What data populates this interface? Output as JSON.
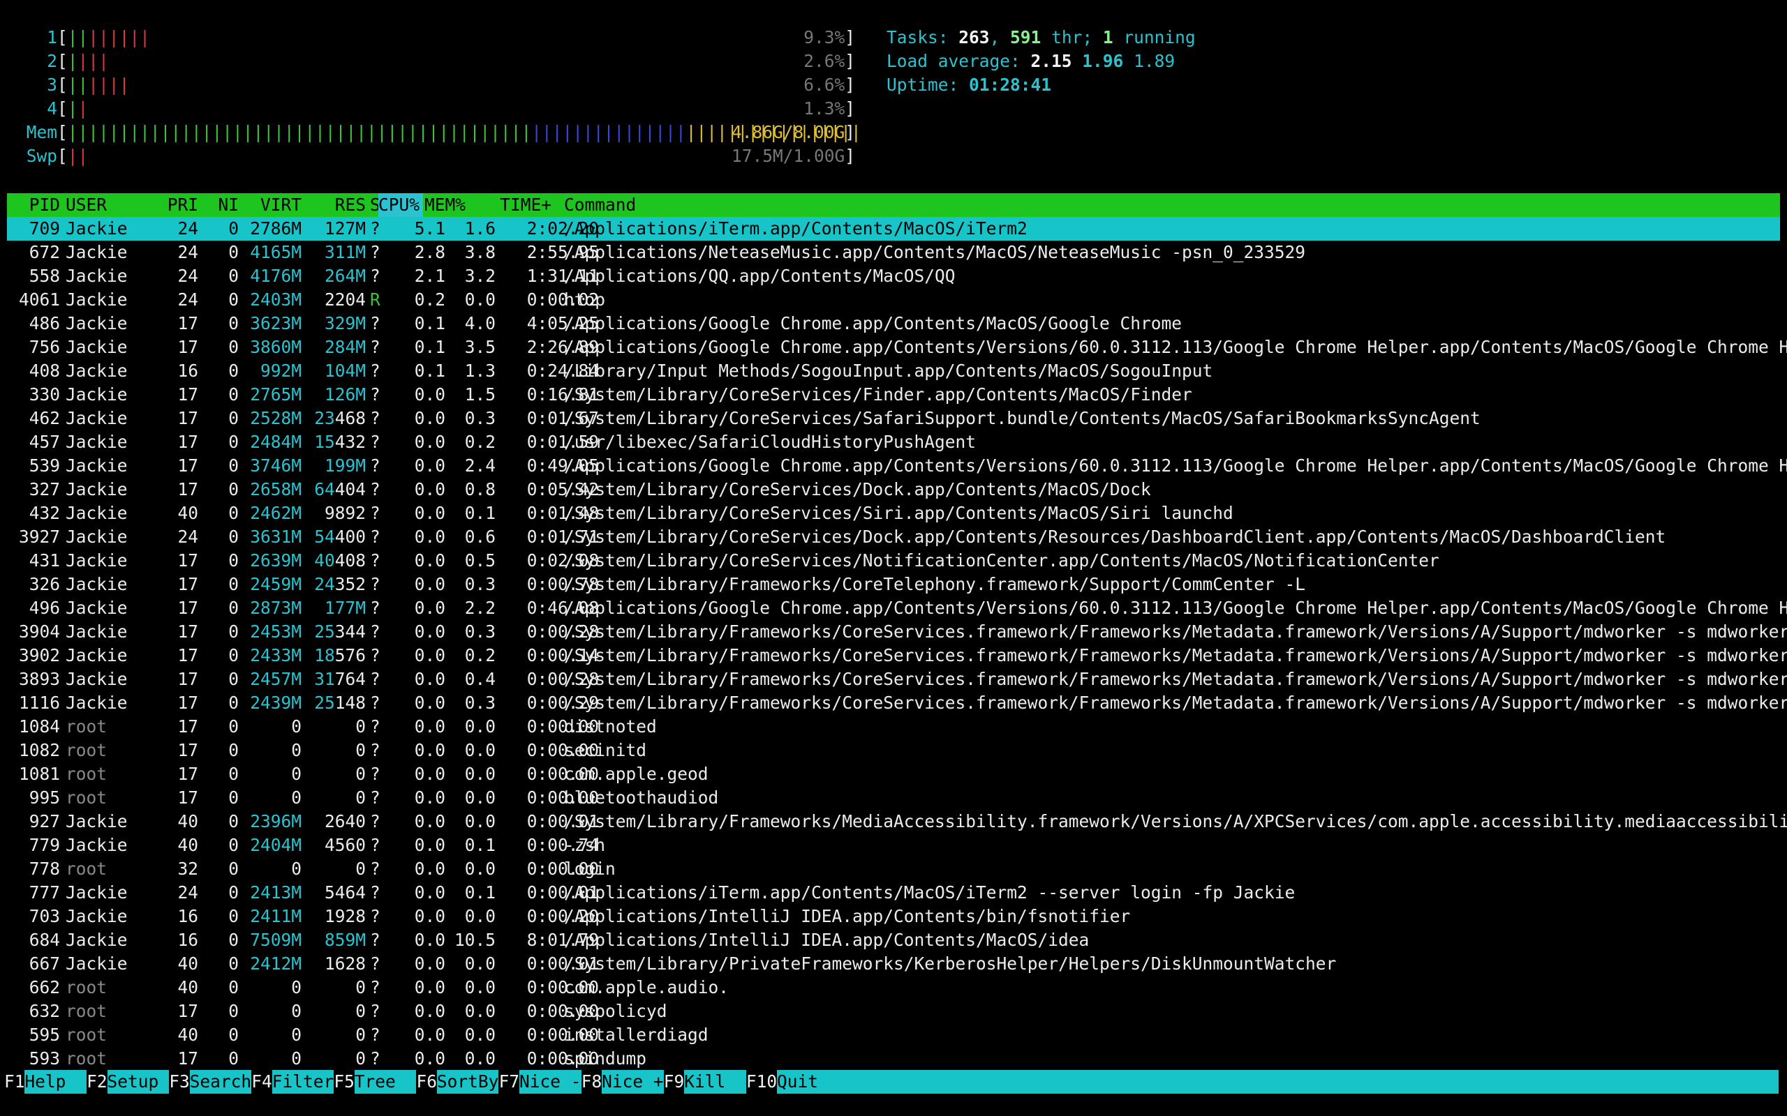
{
  "meters": [
    {
      "label": "1",
      "bar": "||||||||",
      "value": "9.3%"
    },
    {
      "label": "2",
      "bar": "||||",
      "value": "2.6%"
    },
    {
      "label": "3",
      "bar": "||||||",
      "value": "6.6%"
    },
    {
      "label": "4",
      "bar": "||",
      "value": "1.3%"
    },
    {
      "label": "Mem",
      "bar": "||||||||||||||||||||||||||||||||||||||||||||||||||||||||||||||||||||||||||||||",
      "value": "4.86G/8.00G"
    },
    {
      "label": "Swp",
      "bar": "||",
      "value": "17.5M/1.00G"
    }
  ],
  "summary": {
    "tasks_label": "Tasks: ",
    "tasks": "263",
    "comma": ", ",
    "threads": "591",
    "thr_label": " thr; ",
    "running": "1",
    "running_label": " running",
    "load_label": "Load average: ",
    "load1": "2.15",
    "load5": "1.96",
    "load15": "1.89",
    "uptime_label": "Uptime: ",
    "uptime": "01:28:41"
  },
  "header": {
    "pid": "PID",
    "user": "USER",
    "pri": "PRI",
    "ni": "NI",
    "virt": "VIRT",
    "res": "RES",
    "s": "S",
    "cpu": "CPU%",
    "mem": "MEM%",
    "time": "TIME+",
    "cmd": "Command"
  },
  "processes": [
    {
      "pid": "709",
      "user": "Jackie",
      "pri": "24",
      "ni": "0",
      "virt": "2786M",
      "res": "127M",
      "s": "?",
      "cpu": "5.1",
      "mem": "1.6",
      "time": "2:02.20",
      "cmd": "/Applications/iTerm.app/Contents/MacOS/iTerm2"
    },
    {
      "pid": "672",
      "user": "Jackie",
      "pri": "24",
      "ni": "0",
      "virt": "4165M",
      "res": "311M",
      "s": "?",
      "cpu": "2.8",
      "mem": "3.8",
      "time": "2:55.95",
      "cmd": "/Applications/NeteaseMusic.app/Contents/MacOS/NeteaseMusic -psn_0_233529"
    },
    {
      "pid": "558",
      "user": "Jackie",
      "pri": "24",
      "ni": "0",
      "virt": "4176M",
      "res": "264M",
      "s": "?",
      "cpu": "2.1",
      "mem": "3.2",
      "time": "1:31.11",
      "cmd": "/Applications/QQ.app/Contents/MacOS/QQ"
    },
    {
      "pid": "4061",
      "user": "Jackie",
      "pri": "24",
      "ni": "0",
      "virt": "2403M",
      "res": "2204",
      "s": "R",
      "cpu": "0.2",
      "mem": "0.0",
      "time": "0:00.02",
      "cmd": "htop"
    },
    {
      "pid": "486",
      "user": "Jackie",
      "pri": "17",
      "ni": "0",
      "virt": "3623M",
      "res": "329M",
      "s": "?",
      "cpu": "0.1",
      "mem": "4.0",
      "time": "4:05.25",
      "cmd": "/Applications/Google Chrome.app/Contents/MacOS/Google Chrome"
    },
    {
      "pid": "756",
      "user": "Jackie",
      "pri": "17",
      "ni": "0",
      "virt": "3860M",
      "res": "284M",
      "s": "?",
      "cpu": "0.1",
      "mem": "3.5",
      "time": "2:26.89",
      "cmd": "/Applications/Google Chrome.app/Contents/Versions/60.0.3112.113/Google Chrome Helper.app/Contents/MacOS/Google Chrome Helper"
    },
    {
      "pid": "408",
      "user": "Jackie",
      "pri": "16",
      "ni": "0",
      "virt": "992M",
      "res": "104M",
      "s": "?",
      "cpu": "0.1",
      "mem": "1.3",
      "time": "0:24.84",
      "cmd": "/Library/Input Methods/SogouInput.app/Contents/MacOS/SogouInput"
    },
    {
      "pid": "330",
      "user": "Jackie",
      "pri": "17",
      "ni": "0",
      "virt": "2765M",
      "res": "126M",
      "s": "?",
      "cpu": "0.0",
      "mem": "1.5",
      "time": "0:16.81",
      "cmd": "/System/Library/CoreServices/Finder.app/Contents/MacOS/Finder"
    },
    {
      "pid": "462",
      "user": "Jackie",
      "pri": "17",
      "ni": "0",
      "virt": "2528M",
      "res": "23468",
      "s": "?",
      "cpu": "0.0",
      "mem": "0.3",
      "time": "0:01.67",
      "cmd": "/System/Library/CoreServices/SafariSupport.bundle/Contents/MacOS/SafariBookmarksSyncAgent"
    },
    {
      "pid": "457",
      "user": "Jackie",
      "pri": "17",
      "ni": "0",
      "virt": "2484M",
      "res": "15432",
      "s": "?",
      "cpu": "0.0",
      "mem": "0.2",
      "time": "0:01.59",
      "cmd": "/usr/libexec/SafariCloudHistoryPushAgent"
    },
    {
      "pid": "539",
      "user": "Jackie",
      "pri": "17",
      "ni": "0",
      "virt": "3746M",
      "res": "199M",
      "s": "?",
      "cpu": "0.0",
      "mem": "2.4",
      "time": "0:49.05",
      "cmd": "/Applications/Google Chrome.app/Contents/Versions/60.0.3112.113/Google Chrome Helper.app/Contents/MacOS/Google Chrome Helper"
    },
    {
      "pid": "327",
      "user": "Jackie",
      "pri": "17",
      "ni": "0",
      "virt": "2658M",
      "res": "64404",
      "s": "?",
      "cpu": "0.0",
      "mem": "0.8",
      "time": "0:05.42",
      "cmd": "/System/Library/CoreServices/Dock.app/Contents/MacOS/Dock"
    },
    {
      "pid": "432",
      "user": "Jackie",
      "pri": "40",
      "ni": "0",
      "virt": "2462M",
      "res": "9892",
      "s": "?",
      "cpu": "0.0",
      "mem": "0.1",
      "time": "0:01.48",
      "cmd": "/System/Library/CoreServices/Siri.app/Contents/MacOS/Siri launchd"
    },
    {
      "pid": "3927",
      "user": "Jackie",
      "pri": "24",
      "ni": "0",
      "virt": "3631M",
      "res": "54400",
      "s": "?",
      "cpu": "0.0",
      "mem": "0.6",
      "time": "0:01.71",
      "cmd": "/System/Library/CoreServices/Dock.app/Contents/Resources/DashboardClient.app/Contents/MacOS/DashboardClient"
    },
    {
      "pid": "431",
      "user": "Jackie",
      "pri": "17",
      "ni": "0",
      "virt": "2639M",
      "res": "40408",
      "s": "?",
      "cpu": "0.0",
      "mem": "0.5",
      "time": "0:02.08",
      "cmd": "/System/Library/CoreServices/NotificationCenter.app/Contents/MacOS/NotificationCenter"
    },
    {
      "pid": "326",
      "user": "Jackie",
      "pri": "17",
      "ni": "0",
      "virt": "2459M",
      "res": "24352",
      "s": "?",
      "cpu": "0.0",
      "mem": "0.3",
      "time": "0:00.78",
      "cmd": "/System/Library/Frameworks/CoreTelephony.framework/Support/CommCenter -L"
    },
    {
      "pid": "496",
      "user": "Jackie",
      "pri": "17",
      "ni": "0",
      "virt": "2873M",
      "res": "177M",
      "s": "?",
      "cpu": "0.0",
      "mem": "2.2",
      "time": "0:46.08",
      "cmd": "/Applications/Google Chrome.app/Contents/Versions/60.0.3112.113/Google Chrome Helper.app/Contents/MacOS/Google Chrome Helper"
    },
    {
      "pid": "3904",
      "user": "Jackie",
      "pri": "17",
      "ni": "0",
      "virt": "2453M",
      "res": "25344",
      "s": "?",
      "cpu": "0.0",
      "mem": "0.3",
      "time": "0:00.28",
      "cmd": "/System/Library/Frameworks/CoreServices.framework/Frameworks/Metadata.framework/Versions/A/Support/mdworker -s mdworker -c M"
    },
    {
      "pid": "3902",
      "user": "Jackie",
      "pri": "17",
      "ni": "0",
      "virt": "2433M",
      "res": "18576",
      "s": "?",
      "cpu": "0.0",
      "mem": "0.2",
      "time": "0:00.14",
      "cmd": "/System/Library/Frameworks/CoreServices.framework/Frameworks/Metadata.framework/Versions/A/Support/mdworker -s mdworker -c M"
    },
    {
      "pid": "3893",
      "user": "Jackie",
      "pri": "17",
      "ni": "0",
      "virt": "2457M",
      "res": "31764",
      "s": "?",
      "cpu": "0.0",
      "mem": "0.4",
      "time": "0:00.28",
      "cmd": "/System/Library/Frameworks/CoreServices.framework/Frameworks/Metadata.framework/Versions/A/Support/mdworker -s mdworker -c M"
    },
    {
      "pid": "1116",
      "user": "Jackie",
      "pri": "17",
      "ni": "0",
      "virt": "2439M",
      "res": "25148",
      "s": "?",
      "cpu": "0.0",
      "mem": "0.3",
      "time": "0:00.29",
      "cmd": "/System/Library/Frameworks/CoreServices.framework/Frameworks/Metadata.framework/Versions/A/Support/mdworker -s mdworker -c M"
    },
    {
      "pid": "1084",
      "user": "root",
      "pri": "17",
      "ni": "0",
      "virt": "0",
      "res": "0",
      "s": "?",
      "cpu": "0.0",
      "mem": "0.0",
      "time": "0:00.00",
      "cmd": "distnoted"
    },
    {
      "pid": "1082",
      "user": "root",
      "pri": "17",
      "ni": "0",
      "virt": "0",
      "res": "0",
      "s": "?",
      "cpu": "0.0",
      "mem": "0.0",
      "time": "0:00.00",
      "cmd": "secinitd"
    },
    {
      "pid": "1081",
      "user": "root",
      "pri": "17",
      "ni": "0",
      "virt": "0",
      "res": "0",
      "s": "?",
      "cpu": "0.0",
      "mem": "0.0",
      "time": "0:00.00",
      "cmd": "com.apple.geod"
    },
    {
      "pid": "995",
      "user": "root",
      "pri": "17",
      "ni": "0",
      "virt": "0",
      "res": "0",
      "s": "?",
      "cpu": "0.0",
      "mem": "0.0",
      "time": "0:00.00",
      "cmd": "bluetoothaudiod"
    },
    {
      "pid": "927",
      "user": "Jackie",
      "pri": "40",
      "ni": "0",
      "virt": "2396M",
      "res": "2640",
      "s": "?",
      "cpu": "0.0",
      "mem": "0.0",
      "time": "0:00.01",
      "cmd": "/System/Library/Frameworks/MediaAccessibility.framework/Versions/A/XPCServices/com.apple.accessibility.mediaaccessibilityd.x"
    },
    {
      "pid": "779",
      "user": "Jackie",
      "pri": "40",
      "ni": "0",
      "virt": "2404M",
      "res": "4560",
      "s": "?",
      "cpu": "0.0",
      "mem": "0.1",
      "time": "0:00.74",
      "cmd": "-zsh"
    },
    {
      "pid": "778",
      "user": "root",
      "pri": "32",
      "ni": "0",
      "virt": "0",
      "res": "0",
      "s": "?",
      "cpu": "0.0",
      "mem": "0.0",
      "time": "0:00.00",
      "cmd": "login"
    },
    {
      "pid": "777",
      "user": "Jackie",
      "pri": "24",
      "ni": "0",
      "virt": "2413M",
      "res": "5464",
      "s": "?",
      "cpu": "0.0",
      "mem": "0.1",
      "time": "0:00.01",
      "cmd": "/Applications/iTerm.app/Contents/MacOS/iTerm2 --server login -fp Jackie"
    },
    {
      "pid": "703",
      "user": "Jackie",
      "pri": "16",
      "ni": "0",
      "virt": "2411M",
      "res": "1928",
      "s": "?",
      "cpu": "0.0",
      "mem": "0.0",
      "time": "0:00.20",
      "cmd": "/Applications/IntelliJ IDEA.app/Contents/bin/fsnotifier"
    },
    {
      "pid": "684",
      "user": "Jackie",
      "pri": "16",
      "ni": "0",
      "virt": "7509M",
      "res": "859M",
      "s": "?",
      "cpu": "0.0",
      "mem": "10.5",
      "time": "8:01.79",
      "cmd": "/Applications/IntelliJ IDEA.app/Contents/MacOS/idea"
    },
    {
      "pid": "667",
      "user": "Jackie",
      "pri": "40",
      "ni": "0",
      "virt": "2412M",
      "res": "1628",
      "s": "?",
      "cpu": "0.0",
      "mem": "0.0",
      "time": "0:00.01",
      "cmd": "/System/Library/PrivateFrameworks/KerberosHelper/Helpers/DiskUnmountWatcher"
    },
    {
      "pid": "662",
      "user": "root",
      "pri": "40",
      "ni": "0",
      "virt": "0",
      "res": "0",
      "s": "?",
      "cpu": "0.0",
      "mem": "0.0",
      "time": "0:00.00",
      "cmd": "com.apple.audio."
    },
    {
      "pid": "632",
      "user": "root",
      "pri": "17",
      "ni": "0",
      "virt": "0",
      "res": "0",
      "s": "?",
      "cpu": "0.0",
      "mem": "0.0",
      "time": "0:00.00",
      "cmd": "syspolicyd"
    },
    {
      "pid": "595",
      "user": "root",
      "pri": "40",
      "ni": "0",
      "virt": "0",
      "res": "0",
      "s": "?",
      "cpu": "0.0",
      "mem": "0.0",
      "time": "0:00.00",
      "cmd": "installerdiagd"
    },
    {
      "pid": "593",
      "user": "root",
      "pri": "17",
      "ni": "0",
      "virt": "0",
      "res": "0",
      "s": "?",
      "cpu": "0.0",
      "mem": "0.0",
      "time": "0:00.00",
      "cmd": "spindump"
    }
  ],
  "fkeys": [
    {
      "key": "F1",
      "label": "Help  "
    },
    {
      "key": "F2",
      "label": "Setup "
    },
    {
      "key": "F3",
      "label": "Search"
    },
    {
      "key": "F4",
      "label": "Filter"
    },
    {
      "key": "F5",
      "label": "Tree  "
    },
    {
      "key": "F6",
      "label": "SortBy"
    },
    {
      "key": "F7",
      "label": "Nice -"
    },
    {
      "key": "F8",
      "label": "Nice +"
    },
    {
      "key": "F9",
      "label": "Kill  "
    },
    {
      "key": "F10",
      "label": "Quit  "
    }
  ],
  "colors": {
    "header_bg": "#1ec51e",
    "selected_bg": "#17c4c8",
    "accent": "#2bc3d0"
  }
}
